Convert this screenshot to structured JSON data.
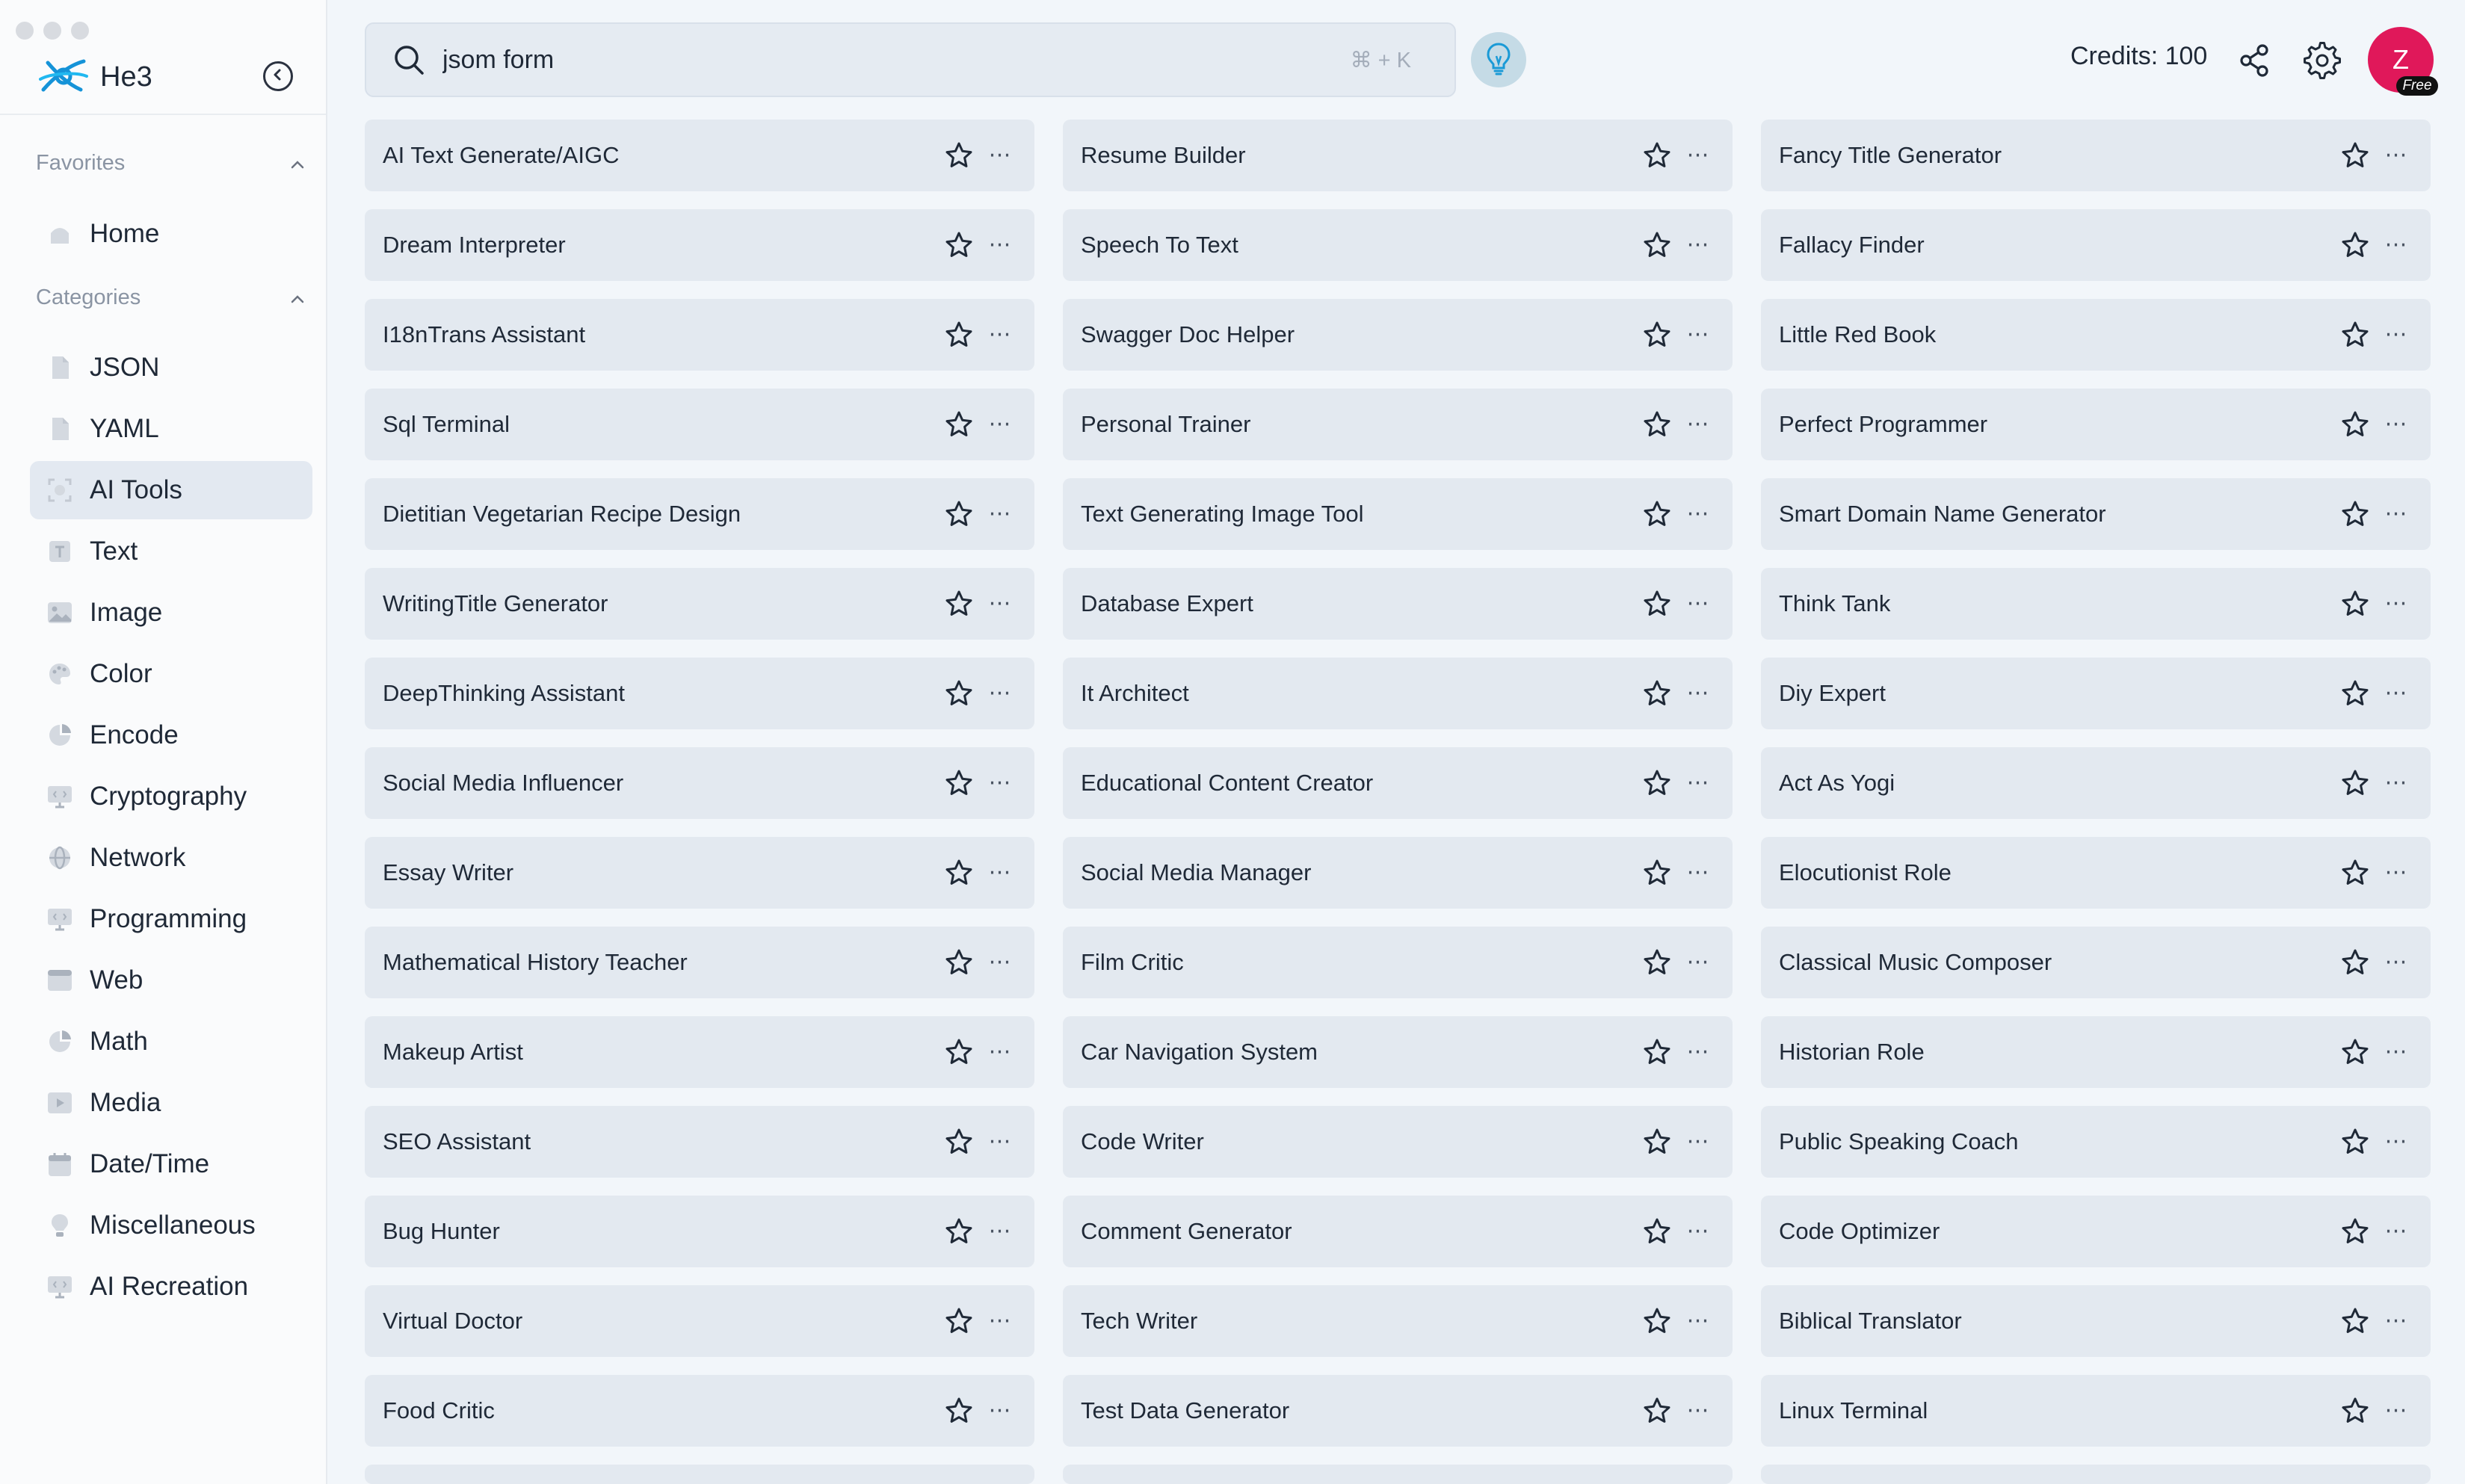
{
  "app": {
    "name": "He3"
  },
  "sidebar": {
    "favorites_label": "Favorites",
    "categories_label": "Categories",
    "favorites": [
      {
        "label": "Home",
        "icon": "home-icon"
      }
    ],
    "categories": [
      {
        "label": "JSON",
        "icon": "file-icon"
      },
      {
        "label": "YAML",
        "icon": "file-icon"
      },
      {
        "label": "AI Tools",
        "icon": "ai-tools-icon",
        "active": true
      },
      {
        "label": "Text",
        "icon": "text-icon"
      },
      {
        "label": "Image",
        "icon": "image-icon"
      },
      {
        "label": "Color",
        "icon": "palette-icon"
      },
      {
        "label": "Encode",
        "icon": "pie-icon"
      },
      {
        "label": "Cryptography",
        "icon": "monitor-icon"
      },
      {
        "label": "Network",
        "icon": "globe-icon"
      },
      {
        "label": "Programming",
        "icon": "monitor-icon"
      },
      {
        "label": "Web",
        "icon": "browser-icon"
      },
      {
        "label": "Math",
        "icon": "pie-icon"
      },
      {
        "label": "Media",
        "icon": "play-icon"
      },
      {
        "label": "Date/Time",
        "icon": "calendar-icon"
      },
      {
        "label": "Miscellaneous",
        "icon": "bulb-icon"
      },
      {
        "label": "AI Recreation",
        "icon": "monitor-icon"
      }
    ]
  },
  "search": {
    "value": "jsom form",
    "shortcut": "⌘ + K"
  },
  "header": {
    "credits": "Credits: 100",
    "avatar_letter": "Z",
    "plan_badge": "Free"
  },
  "colors": {
    "accent": "#e0185a",
    "card_bg": "#e3e9f0",
    "page_bg": "#f2f6fa"
  },
  "tools": [
    [
      "AI Text Generate/AIGC",
      "Resume Builder",
      "Fancy Title Generator"
    ],
    [
      "Dream Interpreter",
      "Speech To Text",
      "Fallacy Finder"
    ],
    [
      "I18nTrans Assistant",
      "Swagger Doc Helper",
      "Little Red Book"
    ],
    [
      "Sql Terminal",
      "Personal Trainer",
      "Perfect Programmer"
    ],
    [
      "Dietitian Vegetarian Recipe Design",
      "Text Generating Image Tool",
      "Smart Domain Name Generator"
    ],
    [
      "WritingTitle Generator",
      "Database Expert",
      "Think Tank"
    ],
    [
      "DeepThinking Assistant",
      "It Architect",
      "Diy Expert"
    ],
    [
      "Social Media Influencer",
      "Educational Content Creator",
      "Act As Yogi"
    ],
    [
      "Essay Writer",
      "Social Media Manager",
      "Elocutionist Role"
    ],
    [
      "Mathematical History Teacher",
      "Film Critic",
      "Classical Music Composer"
    ],
    [
      "Makeup Artist",
      "Car Navigation System",
      "Historian Role"
    ],
    [
      "SEO Assistant",
      "Code Writer",
      "Public Speaking Coach"
    ],
    [
      "Bug Hunter",
      "Comment Generator",
      "Code Optimizer"
    ],
    [
      "Virtual Doctor",
      "Tech Writer",
      "Biblical Translator"
    ],
    [
      "Food Critic",
      "Test Data Generator",
      "Linux Terminal"
    ]
  ]
}
